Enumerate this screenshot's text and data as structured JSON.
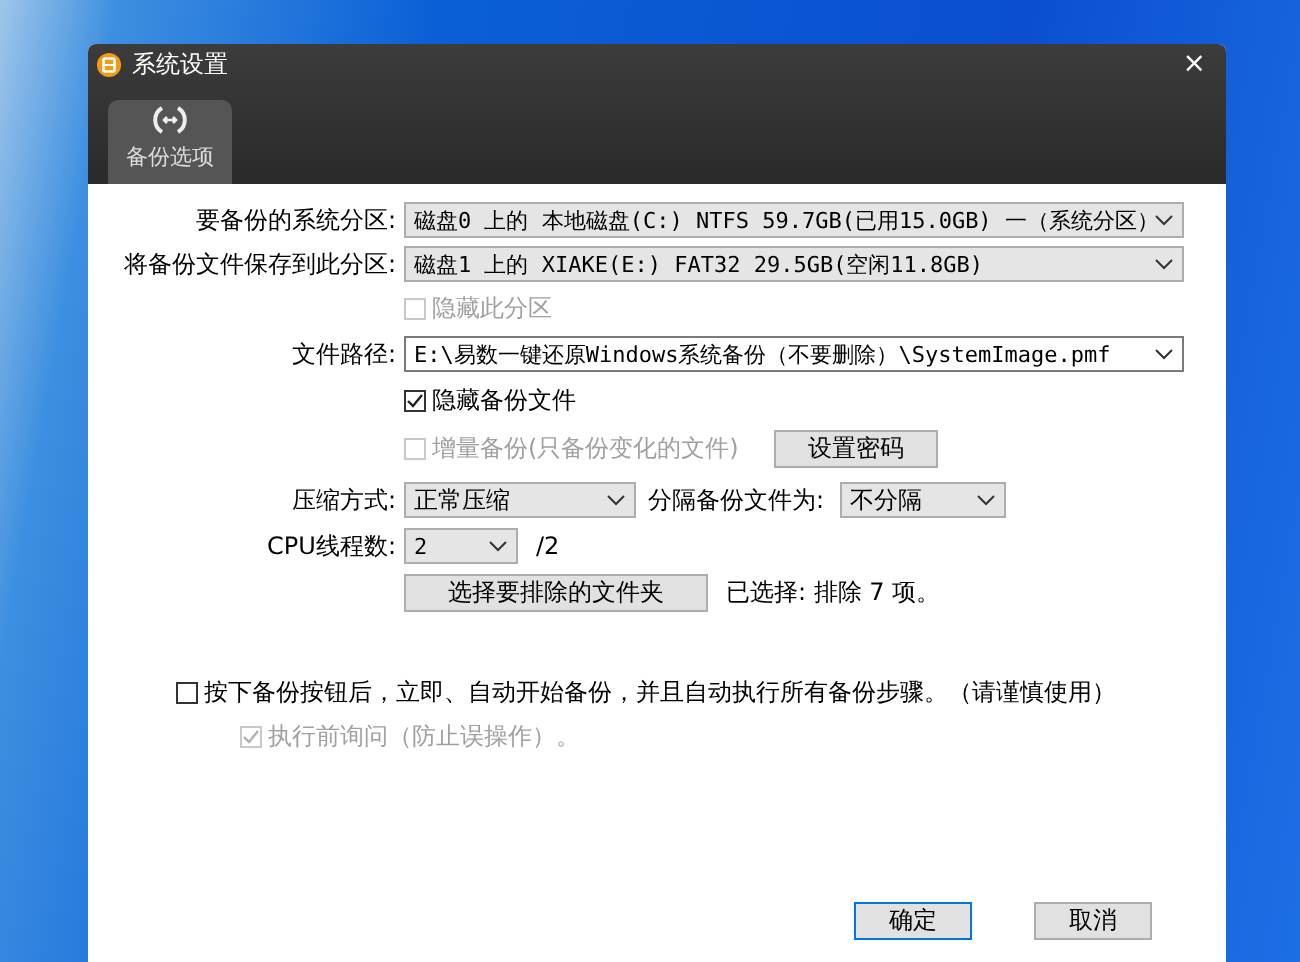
{
  "window": {
    "title": "系统设置",
    "close": "×"
  },
  "tabs": [
    {
      "label": "备份选项",
      "selected": true
    }
  ],
  "source_partition": {
    "label": "要备份的系统分区:",
    "value": "磁盘0 上的 本地磁盘(C:) NTFS 59.7GB(已用15.0GB) 一（系统分区）"
  },
  "target_partition": {
    "label": "将备份文件保存到此分区:",
    "value": "磁盘1 上的 XIAKE(E:) FAT32 29.5GB(空闲11.8GB)"
  },
  "hide_partition": {
    "label": "隐藏此分区",
    "checked": false,
    "disabled": true
  },
  "file_path": {
    "label": "文件路径:",
    "value": "E:\\易数一键还原Windows系统备份（不要删除）\\SystemImage.pmf"
  },
  "hide_file": {
    "label": "隐藏备份文件",
    "checked": true,
    "disabled": false
  },
  "incremental": {
    "label": "增量备份(只备份变化的文件)",
    "checked": false,
    "disabled": true
  },
  "password_button": "设置密码",
  "compression": {
    "label": "压缩方式:",
    "value": "正常压缩"
  },
  "split": {
    "label": "分隔备份文件为:",
    "value": "不分隔"
  },
  "cpu_threads": {
    "label": "CPU线程数:",
    "value": "2",
    "max": "/2"
  },
  "exclude_button": "选择要排除的文件夹",
  "exclude_status": "已选择: 排除 7 项。",
  "auto_start": {
    "label": "按下备份按钮后，立即、自动开始备份，并且自动执行所有备份步骤。（请谨慎使用）",
    "checked": false,
    "disabled": false
  },
  "confirm_before": {
    "label": "执行前询问（防止误操作）。",
    "checked": true,
    "disabled": true
  },
  "buttons": [
    {
      "label": "确定",
      "default": true
    },
    {
      "label": "取消",
      "default": false
    }
  ]
}
